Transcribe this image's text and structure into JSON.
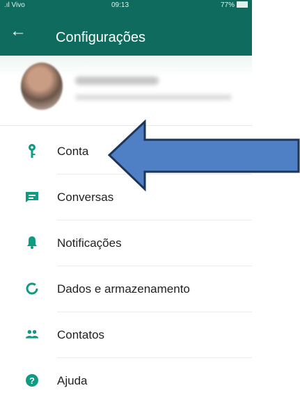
{
  "status_bar": {
    "carrier": ".ıl Vivo ",
    "time": "09:13",
    "battery": "77%"
  },
  "header": {
    "title": "Configurações"
  },
  "menu": {
    "items": [
      {
        "label": "Conta",
        "icon": "key-icon"
      },
      {
        "label": "Conversas",
        "icon": "chat-icon"
      },
      {
        "label": "Notificações",
        "icon": "bell-icon"
      },
      {
        "label": "Dados e armazenamento",
        "icon": "data-usage-icon"
      },
      {
        "label": "Contatos",
        "icon": "contacts-icon"
      },
      {
        "label": "Ajuda",
        "icon": "help-icon"
      }
    ]
  },
  "colors": {
    "header": "#0f6b5e",
    "accent": "#0f9b82",
    "arrow_fill": "#4f7fc4",
    "arrow_stroke": "#1d3557"
  }
}
